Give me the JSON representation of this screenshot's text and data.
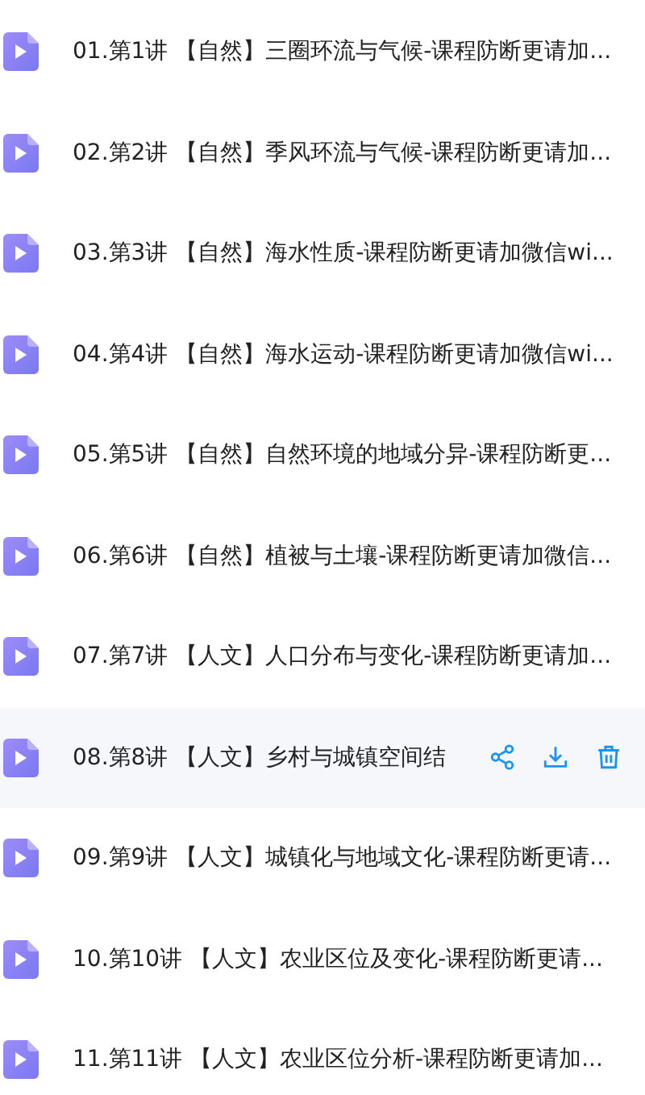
{
  "files": [
    {
      "title": "01.第1讲 【自然】三圈环流与气候-课程防断更请加...",
      "selected": false
    },
    {
      "title": "02.第2讲 【自然】季风环流与气候-课程防断更请加...",
      "selected": false
    },
    {
      "title": "03.第3讲 【自然】海水性质-课程防断更请加微信wi...",
      "selected": false
    },
    {
      "title": "04.第4讲 【自然】海水运动-课程防断更请加微信wi...",
      "selected": false
    },
    {
      "title": "05.第5讲 【自然】自然环境的地域分异-课程防断更...",
      "selected": false
    },
    {
      "title": "06.第6讲 【自然】植被与土壤-课程防断更请加微信...",
      "selected": false
    },
    {
      "title": "07.第7讲 【人文】人口分布与变化-课程防断更请加...",
      "selected": false
    },
    {
      "title": "08.第8讲 【人文】乡村与城镇空间结",
      "selected": true
    },
    {
      "title": "09.第9讲 【人文】城镇化与地域文化-课程防断更请...",
      "selected": false
    },
    {
      "title": "10.第10讲 【人文】农业区位及变化-课程防断更请...",
      "selected": false
    },
    {
      "title": "11.第11讲 【人文】农业区位分析-课程防断更请加...",
      "selected": false
    }
  ]
}
